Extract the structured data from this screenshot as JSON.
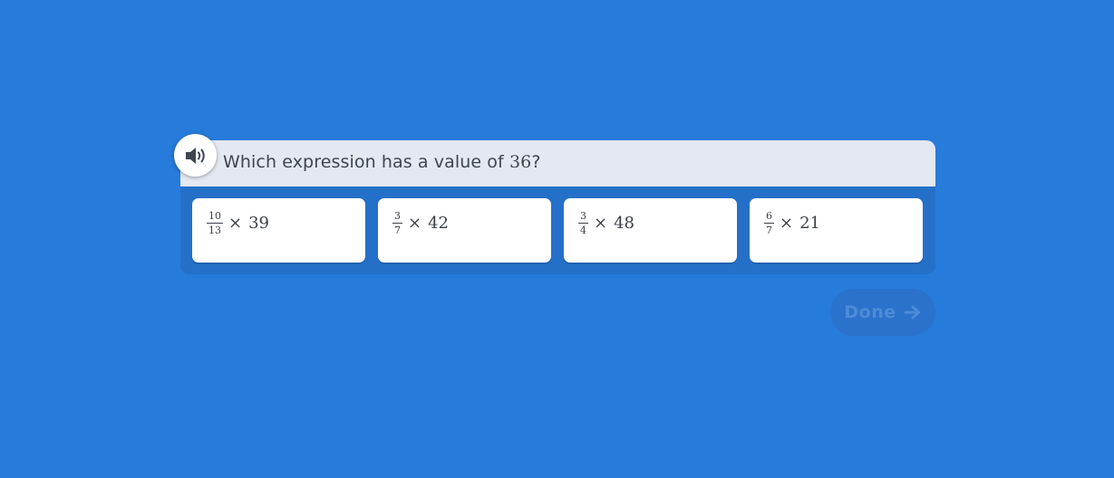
{
  "question": {
    "prefix": "Which expression has a value of ",
    "target": "36",
    "suffix": "?"
  },
  "audio": {
    "icon": "speaker-icon"
  },
  "choices": [
    {
      "numerator": "10",
      "denominator": "13",
      "operator": "×",
      "factor": "39"
    },
    {
      "numerator": "3",
      "denominator": "7",
      "operator": "×",
      "factor": "42"
    },
    {
      "numerator": "3",
      "denominator": "4",
      "operator": "×",
      "factor": "48"
    },
    {
      "numerator": "6",
      "denominator": "7",
      "operator": "×",
      "factor": "21"
    }
  ],
  "done": {
    "label": "Done",
    "icon": "arrow-right-icon",
    "enabled": false
  },
  "colors": {
    "background": "#277bda",
    "header": "#e3e8f1",
    "card": "#2470c8",
    "done_disabled": "#4d8bd6"
  }
}
